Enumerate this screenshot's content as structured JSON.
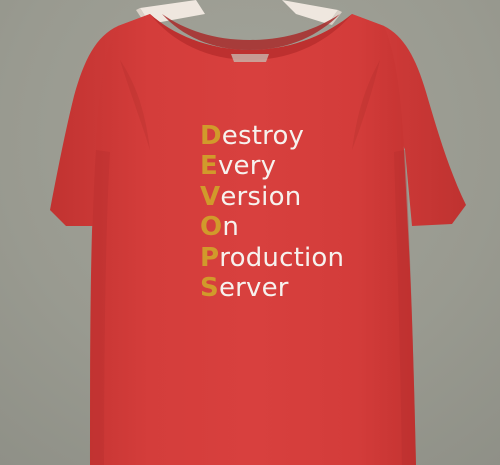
{
  "photo": {
    "subject": "red t-shirt on hanger",
    "colors": {
      "background": "#9a9b91",
      "shirt": "#d43d3b",
      "shirt_shadow": "#b83130",
      "hanger": "#efe7df",
      "acronym": "#d19a2b",
      "text": "#f6f2ee"
    }
  },
  "print": {
    "lines": [
      {
        "initial": "D",
        "rest": "estroy"
      },
      {
        "initial": "E",
        "rest": "very"
      },
      {
        "initial": "V",
        "rest": "ersion"
      },
      {
        "initial": "O",
        "rest": "n"
      },
      {
        "initial": "P",
        "rest": "roduction"
      },
      {
        "initial": "S",
        "rest": "erver"
      }
    ]
  }
}
